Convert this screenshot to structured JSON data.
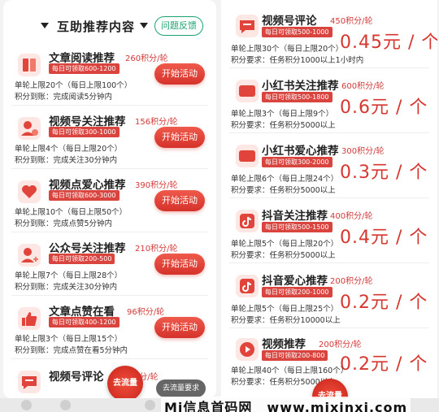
{
  "left_panel": {
    "title": "互助推荐内容",
    "feedback_label": "问题反馈",
    "items": [
      {
        "name": "文章阅读推荐",
        "points": "260积分/轮",
        "tag": "每日可领取600-1200",
        "line1": "单轮上限20个（每日上限100个）",
        "line2": "积分到账：完成阅读5分钟内",
        "button": "开始活动"
      },
      {
        "name": "视频号关注推荐",
        "points": "156积分/轮",
        "tag": "每日可领取300-1000",
        "line1": "单轮上限4个（每日上限20个）",
        "line2": "积分到账：完成关注30分钟内",
        "button": "开始活动"
      },
      {
        "name": "视频点爱心推荐",
        "points": "390积分/轮",
        "tag": "每日可领取600-3000",
        "line1": "单轮上限10个（每日上限50个）",
        "line2": "积分到账：完成点赞5分钟内",
        "button": "开始活动"
      },
      {
        "name": "公众号关注推荐",
        "points": "210积分/轮",
        "tag": "每日可领取200-500",
        "line1": "单轮上限7个（每日上限28个）",
        "line2": "积分到账：完成关注30分钟内",
        "button": "开始活动"
      },
      {
        "name": "文章点赞在看",
        "points": "96积分/轮",
        "tag": "每日可领取400-1200",
        "line1": "单轮上限3个（每日上限15个）",
        "line2": "积分到账：完成点赞在看5分钟内",
        "button": "开始活动"
      },
      {
        "name": "视频号评论",
        "points": "450积分/轮"
      }
    ],
    "badge": "去流量",
    "bubble": "去流量要求"
  },
  "right_panel": {
    "items": [
      {
        "name": "视频号评论",
        "points": "450积分/轮",
        "tag": "每日可领取500-1000",
        "line1": "单轮上限30个（每日上限20个）",
        "line2": "积分要求：任务积分1000以上1小时内",
        "price": "0.45元 / 个"
      },
      {
        "name": "小红书关注推荐",
        "points": "600积分/轮",
        "tag": "每日可领取500-1800",
        "line1": "单轮上限3个（每日上限9个）",
        "line2": "积分要求：任务积分5000以上",
        "price": "0.6元 / 个",
        "icon_text": "小红书"
      },
      {
        "name": "小红书爱心推荐",
        "points": "300积分/轮",
        "tag": "每日可领取300-2000",
        "line1": "单轮上限6个（每日上限24个）",
        "line2": "积分要求：任务积分5000以上",
        "price": "0.3元 / 个",
        "icon_text": "小红书"
      },
      {
        "name": "抖音关注推荐",
        "points": "400积分/轮",
        "tag": "每日可领取500-1500",
        "line1": "单轮上限5个（每日上限20个）",
        "line2": "积分要求：任务积分5000以上",
        "price": "0.4元 / 个"
      },
      {
        "name": "抖音爱心推荐",
        "points": "200积分/轮",
        "tag": "每日可领取200-1000",
        "line1": "单轮上限5个（每日上限25个）",
        "line2": "积分要求：任务积分10000以上",
        "price": "0.2元 / 个"
      },
      {
        "name": "视频推荐",
        "points": "200积分/轮",
        "tag": "每日可领取200-800",
        "line1": "单轮上限40个（每日上限160个）",
        "line2": "积分要求：任务积分5000以上",
        "price": "0.2元 / 个"
      }
    ],
    "badge": "去流量"
  },
  "watermark": {
    "brand": "Mi信息首码网",
    "url": "www.mixinxi.com"
  },
  "colors": {
    "accent": "#d6372f",
    "tag_bg": "#d9443f",
    "feedback": "#1aa36f"
  }
}
